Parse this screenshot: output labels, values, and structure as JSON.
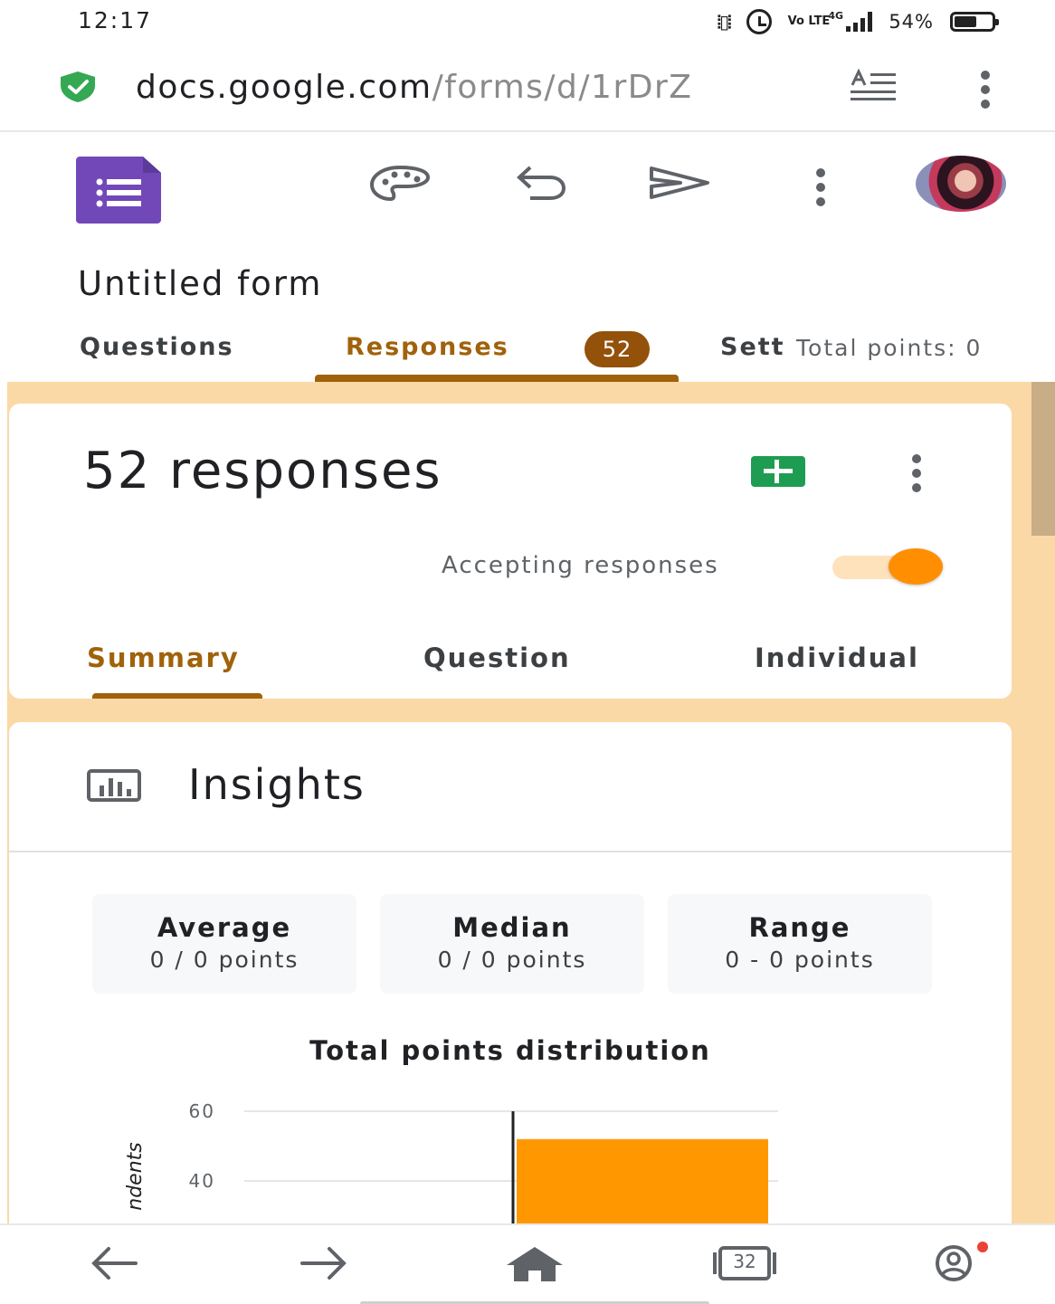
{
  "status_bar": {
    "time": "12:17",
    "volte": "Vo LTE",
    "network": "4G",
    "battery_percent": "54%"
  },
  "browser": {
    "url_host": "docs.google.com",
    "url_path": "/forms/d/1rDrZ",
    "secure_icon": "shield-check-icon",
    "reader_icon": "reader-mode-icon"
  },
  "toolbar": {
    "app_icon": "google-forms-icon",
    "icons": [
      "palette-icon",
      "undo-icon",
      "send-icon",
      "more-vert-icon"
    ]
  },
  "form": {
    "title": "Untitled form"
  },
  "main_tabs": {
    "questions": "Questions",
    "responses": "Responses",
    "responses_badge": "52",
    "settings": "Sett",
    "total_points": "Total points: 0",
    "active": "responses"
  },
  "responses_card": {
    "count_label": "52 responses",
    "accepting_label": "Accepting responses",
    "accepting_on": true,
    "sub_tabs": {
      "summary": "Summary",
      "question": "Question",
      "individual": "Individual"
    },
    "active_sub_tab": "summary"
  },
  "insights": {
    "title": "Insights",
    "stats": [
      {
        "label": "Average",
        "value": "0 / 0 points"
      },
      {
        "label": "Median",
        "value": "0 / 0 points"
      },
      {
        "label": "Range",
        "value": "0 - 0 points"
      }
    ]
  },
  "chart_data": {
    "type": "bar",
    "title": "Total points distribution",
    "ylabel": "ndents",
    "yticks": [
      "60",
      "40"
    ],
    "ylim": [
      0,
      60
    ],
    "values": [
      52
    ],
    "grid": true
  },
  "bottom_nav": {
    "tabs_count": "32"
  },
  "colors": {
    "accent": "#a0620a",
    "badge": "#93510a",
    "background": "#fbd9a6",
    "toggle": "#ff8f00",
    "bar": "#ff9800",
    "sheets": "#1e9d52",
    "forms_purple": "#7248b9"
  }
}
